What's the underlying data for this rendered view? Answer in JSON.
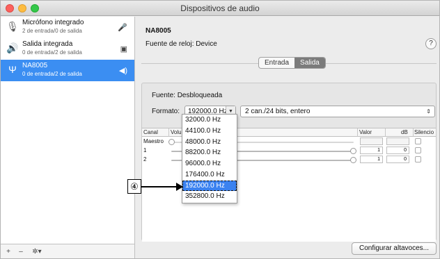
{
  "window": {
    "title": "Dispositivos de audio"
  },
  "sidebar": {
    "devices": [
      {
        "name": "Micrófono integrado",
        "sub": "2 de entrada/0 de salida",
        "icon": "microphone-icon",
        "badge": "mic-indicator-icon"
      },
      {
        "name": "Salida integrada",
        "sub": "0 de entrada/2 de salida",
        "icon": "speaker-icon",
        "badge": "finder-icon"
      },
      {
        "name": "NA8005",
        "sub": "0 de entrada/2 de salida",
        "icon": "usb-icon",
        "badge": "volume-icon",
        "selected": true
      }
    ],
    "footer": {
      "add": "+",
      "remove": "–",
      "gear": "✲▾"
    }
  },
  "main": {
    "device_title": "NA8005",
    "clock_source": "Fuente de reloj: Device",
    "help": "?",
    "tabs": [
      {
        "label": "Entrada",
        "active": false
      },
      {
        "label": "Salida",
        "active": true
      }
    ],
    "source": "Fuente:  Desbloqueada",
    "format_label": "Formato:",
    "rate_value": "192000.0 Hz",
    "channel_format": "2 can./24 bits, entero",
    "table": {
      "headers": {
        "canal": "Canal",
        "volume": "Volu",
        "valor": "Valor",
        "db": "dB",
        "silencio": "Silencio"
      },
      "rows": [
        {
          "label": "Maestro",
          "valor": "",
          "db": ""
        },
        {
          "label": "1",
          "valor": "1",
          "db": "0"
        },
        {
          "label": "2",
          "valor": "1",
          "db": "0"
        }
      ]
    },
    "configure_button": "Configurar altavoces..."
  },
  "dropdown": {
    "options": [
      "32000.0 Hz",
      "44100.0 Hz",
      "48000.0 Hz",
      "88200.0 Hz",
      "96000.0 Hz",
      "176400.0 Hz",
      "192000.0 Hz",
      "352800.0 Hz"
    ],
    "selected_index": 6
  },
  "callout": {
    "label": "④"
  }
}
